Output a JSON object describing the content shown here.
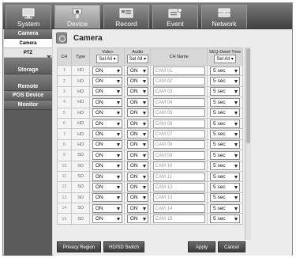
{
  "top_tabs": [
    {
      "label": "System",
      "icon": "monitor-icon"
    },
    {
      "label": "Device",
      "icon": "camera-icon"
    },
    {
      "label": "Record",
      "icon": "record-icon"
    },
    {
      "label": "Event",
      "icon": "event-icon"
    },
    {
      "label": "Network",
      "icon": "network-icon"
    }
  ],
  "sidebar": {
    "items": [
      {
        "label": "Camera",
        "type": "header"
      },
      {
        "label": "Camera",
        "type": "sub",
        "active": true
      },
      {
        "label": "PTZ",
        "type": "sub"
      },
      {
        "label": "Storage\nDevice",
        "type": "header"
      },
      {
        "label": "Remote\nDevice",
        "type": "header"
      },
      {
        "label": "POS Device",
        "type": "header"
      },
      {
        "label": "Monitor",
        "type": "header"
      }
    ]
  },
  "main": {
    "title": "Camera",
    "headers": {
      "ch": "CH",
      "type": "Type",
      "video": "Video",
      "audio": "Audio",
      "name": "CH Name",
      "dwell": "SEQ-Dwell Time",
      "sel_all": "Sel All"
    },
    "rows": [
      {
        "ch": "1",
        "type": "HD",
        "video": "ON",
        "audio": "ON",
        "name": "CAM 01",
        "dwell": "5 sec"
      },
      {
        "ch": "2",
        "type": "HD",
        "video": "ON",
        "audio": "ON",
        "name": "CAM 02",
        "dwell": "5 sec"
      },
      {
        "ch": "3",
        "type": "HD",
        "video": "ON",
        "audio": "ON",
        "name": "CAM 03",
        "dwell": "5 sec"
      },
      {
        "ch": "4",
        "type": "HD",
        "video": "ON",
        "audio": "ON",
        "name": "CAM 04",
        "dwell": "5 sec"
      },
      {
        "ch": "5",
        "type": "HD",
        "video": "ON",
        "audio": "ON",
        "name": "CAM 05",
        "dwell": "5 sec"
      },
      {
        "ch": "6",
        "type": "HD",
        "video": "ON",
        "audio": "ON",
        "name": "CAM 06",
        "dwell": "5 sec"
      },
      {
        "ch": "7",
        "type": "HD",
        "video": "ON",
        "audio": "ON",
        "name": "CAM 07",
        "dwell": "5 sec"
      },
      {
        "ch": "8",
        "type": "HD",
        "video": "ON",
        "audio": "ON",
        "name": "CAM 08",
        "dwell": "5 sec"
      },
      {
        "ch": "9",
        "type": "SD",
        "video": "ON",
        "audio": "ON",
        "name": "CAM 09",
        "dwell": "5 sec"
      },
      {
        "ch": "10",
        "type": "SD",
        "video": "ON",
        "audio": "ON",
        "name": "CAM 10",
        "dwell": "5 sec"
      },
      {
        "ch": "11",
        "type": "SD",
        "video": "ON",
        "audio": "ON",
        "name": "CAM 11",
        "dwell": "5 sec"
      },
      {
        "ch": "12",
        "type": "SD",
        "video": "ON",
        "audio": "ON",
        "name": "CAM 12",
        "dwell": "5 sec"
      },
      {
        "ch": "13",
        "type": "SD",
        "video": "ON",
        "audio": "ON",
        "name": "CAM 13",
        "dwell": "5 sec"
      },
      {
        "ch": "14",
        "type": "SD",
        "video": "ON",
        "audio": "ON",
        "name": "CAM 14",
        "dwell": "5 sec"
      },
      {
        "ch": "15",
        "type": "SD",
        "video": "ON",
        "audio": "ON",
        "name": "CAM 15",
        "dwell": "5 sec"
      }
    ]
  },
  "buttons": {
    "privacy_region": "Privacy Region",
    "hd_sd_switch": "HD/SD Switch",
    "apply": "Apply",
    "cancel": "Cancel"
  }
}
